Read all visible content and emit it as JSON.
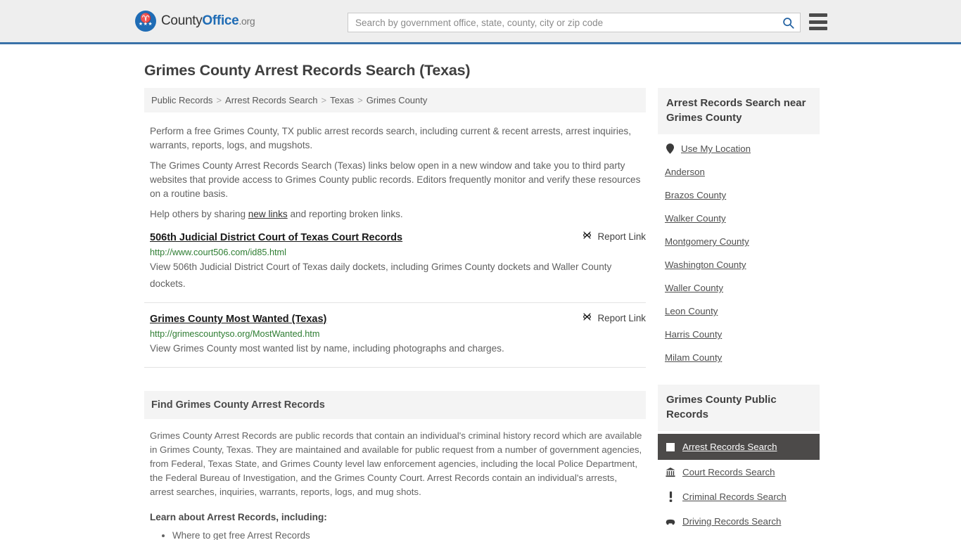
{
  "header": {
    "logo": {
      "part1": "County",
      "part2": "Office",
      "part3": ".org",
      "eagle_glyph": "♈",
      "stars_glyph": "★★★"
    },
    "search": {
      "placeholder": "Search by government office, state, county, city or zip code",
      "value": "",
      "icon": "search-icon"
    },
    "menu_icon": "hamburger-menu-icon",
    "accent_color": "#3a72a8"
  },
  "page": {
    "title": "Grimes County Arrest Records Search (Texas)"
  },
  "breadcrumb": {
    "separator": ">",
    "items": [
      {
        "label": "Public Records"
      },
      {
        "label": "Arrest Records Search"
      },
      {
        "label": "Texas"
      },
      {
        "label": "Grimes County"
      }
    ]
  },
  "intro": {
    "p1": "Perform a free Grimes County, TX public arrest records search, including current & recent arrests, arrest inquiries, warrants, reports, logs, and mugshots.",
    "p2": "The Grimes County Arrest Records Search (Texas) links below open in a new window and take you to third party websites that provide access to Grimes County public records. Editors frequently monitor and verify these resources on a routine basis.",
    "p3_before": "Help others by sharing ",
    "p3_link": "new links",
    "p3_after": " and reporting broken links."
  },
  "links": [
    {
      "title": "506th Judicial District Court of Texas Court Records",
      "url": "http://www.court506.com/id85.html",
      "description": "View 506th Judicial District Court of Texas daily dockets, including Grimes County dockets and Waller County dockets.",
      "report_label": "Report Link",
      "report_icon": "broken-link-icon"
    },
    {
      "title": "Grimes County Most Wanted (Texas)",
      "url": "http://grimescountyso.org/MostWanted.htm",
      "description": "View Grimes County most wanted list by name, including photographs and charges.",
      "report_label": "Report Link",
      "report_icon": "broken-link-icon"
    }
  ],
  "find_section": {
    "heading": "Find Grimes County Arrest Records",
    "body": "Grimes County Arrest Records are public records that contain an individual's criminal history record which are available in Grimes County, Texas. They are maintained and available for public request from a number of government agencies, from Federal, Texas State, and Grimes County level law enforcement agencies, including the local Police Department, the Federal Bureau of Investigation, and the Grimes County Court. Arrest Records contain an individual's arrests, arrest searches, inquiries, warrants, reports, logs, and mug shots.",
    "learn_heading": "Learn about Arrest Records, including:",
    "bullets": [
      {
        "label": "Where to get free Arrest Records"
      }
    ]
  },
  "sidebar": {
    "nearby": {
      "heading": "Arrest Records Search near Grimes County",
      "items": [
        {
          "label": "Use My Location",
          "icon": "map-pin-icon",
          "glyph": "●"
        },
        {
          "label": "Anderson",
          "icon": "",
          "glyph": ""
        },
        {
          "label": "Brazos County",
          "icon": "",
          "glyph": ""
        },
        {
          "label": "Walker County",
          "icon": "",
          "glyph": ""
        },
        {
          "label": "Montgomery County",
          "icon": "",
          "glyph": ""
        },
        {
          "label": "Washington County",
          "icon": "",
          "glyph": ""
        },
        {
          "label": "Waller County",
          "icon": "",
          "glyph": ""
        },
        {
          "label": "Leon County",
          "icon": "",
          "glyph": ""
        },
        {
          "label": "Harris County",
          "icon": "",
          "glyph": ""
        },
        {
          "label": "Milam County",
          "icon": "",
          "glyph": ""
        }
      ]
    },
    "public_records": {
      "heading": "Grimes County Public Records",
      "items": [
        {
          "label": "Arrest Records Search",
          "icon": "white-square-icon",
          "glyph": "",
          "active": true
        },
        {
          "label": "Court Records Search",
          "icon": "courthouse-icon",
          "glyph": "🏛",
          "active": false
        },
        {
          "label": "Criminal Records Search",
          "icon": "exclamation-icon",
          "glyph": "❗",
          "active": false
        },
        {
          "label": "Driving Records Search",
          "icon": "car-icon",
          "glyph": "🚗",
          "active": false
        }
      ]
    }
  }
}
